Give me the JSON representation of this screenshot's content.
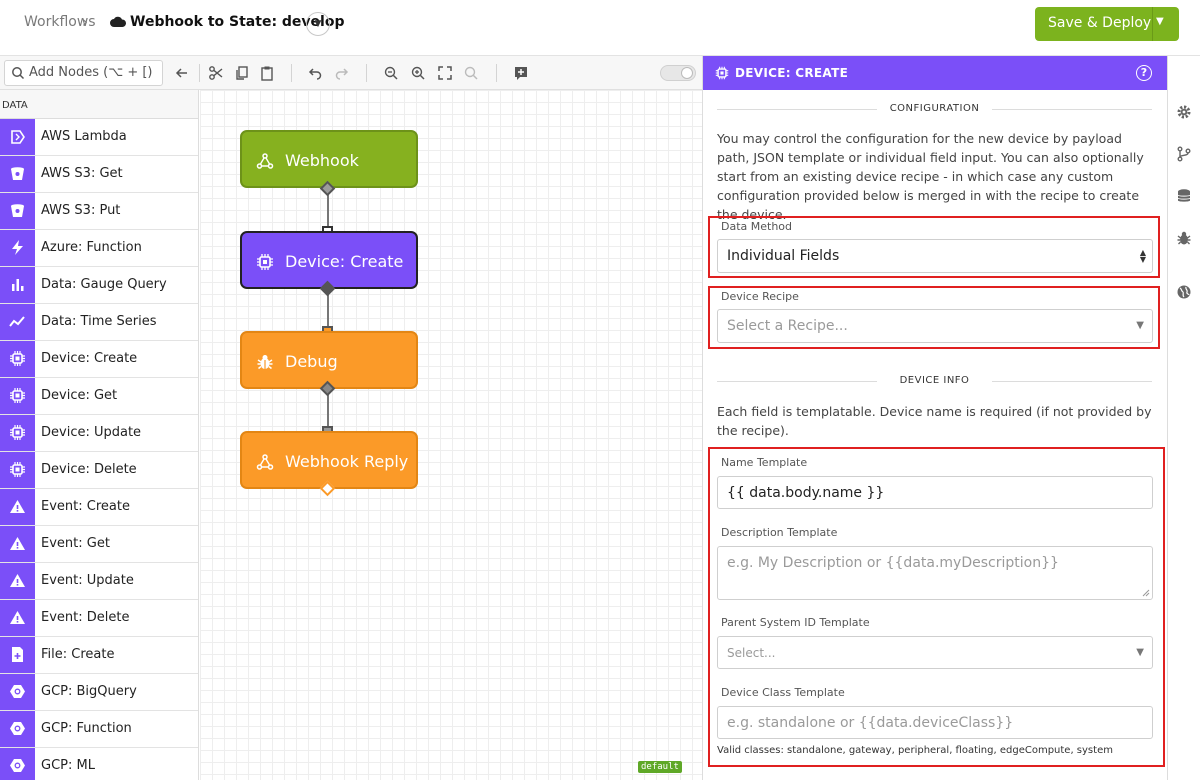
{
  "header": {
    "breadcrumb_root": "Workflows",
    "breadcrumb_sep": "›",
    "workflow_name": "Webhook to State: develop",
    "deploy_label": "Save & Deploy"
  },
  "toolbar": {
    "add_nodes_placeholder": "Add Nodes (⌥ + [)"
  },
  "sidebar": {
    "category": "DATA",
    "items": [
      {
        "label": "AWS Lambda",
        "icon": "aws-lambda-icon"
      },
      {
        "label": "AWS S3: Get",
        "icon": "bucket-icon"
      },
      {
        "label": "AWS S3: Put",
        "icon": "bucket-icon"
      },
      {
        "label": "Azure: Function",
        "icon": "lightning-icon"
      },
      {
        "label": "Data: Gauge Query",
        "icon": "bar-chart-icon"
      },
      {
        "label": "Data: Time Series",
        "icon": "line-chart-icon"
      },
      {
        "label": "Device: Create",
        "icon": "chip-icon"
      },
      {
        "label": "Device: Get",
        "icon": "chip-icon"
      },
      {
        "label": "Device: Update",
        "icon": "chip-icon"
      },
      {
        "label": "Device: Delete",
        "icon": "chip-icon"
      },
      {
        "label": "Event: Create",
        "icon": "event-icon"
      },
      {
        "label": "Event: Get",
        "icon": "event-icon"
      },
      {
        "label": "Event: Update",
        "icon": "event-icon"
      },
      {
        "label": "Event: Delete",
        "icon": "event-icon"
      },
      {
        "label": "File: Create",
        "icon": "file-icon"
      },
      {
        "label": "GCP: BigQuery",
        "icon": "gcp-icon"
      },
      {
        "label": "GCP: Function",
        "icon": "gcp-icon"
      },
      {
        "label": "GCP: ML",
        "icon": "gcp-icon"
      }
    ]
  },
  "canvas": {
    "nodes": [
      {
        "label": "Webhook",
        "color": "#86b11f"
      },
      {
        "label": "Device: Create",
        "color": "#7b4ff8"
      },
      {
        "label": "Debug",
        "color": "#fb9a28"
      },
      {
        "label": "Webhook Reply",
        "color": "#fb9a28"
      }
    ],
    "badge": "default"
  },
  "panel": {
    "title": "DEVICE: CREATE",
    "help": "?",
    "config_title": "CONFIGURATION",
    "config_text": "You may control the configuration for the new device by payload path, JSON template or individual field input. You can also optionally start from an existing device recipe - in which case any custom configuration provided below is merged in with the recipe to create the device.",
    "data_method_label": "Data Method",
    "data_method_value": "Individual Fields",
    "device_recipe_label": "Device Recipe",
    "device_recipe_placeholder": "Select a Recipe...",
    "info_title": "DEVICE INFO",
    "info_text": "Each field is templatable. Device name is required (if not provided by the recipe).",
    "name_label": "Name Template",
    "name_value": "{{ data.body.name }}",
    "desc_label": "Description Template",
    "desc_placeholder": "e.g. My Description or {{data.myDescription}}",
    "parent_label": "Parent System ID Template",
    "parent_placeholder": "Select...",
    "class_label": "Device Class Template",
    "class_placeholder": "e.g. standalone or {{data.deviceClass}}",
    "valid_classes": "Valid classes: standalone, gateway, peripheral, floating, edgeCompute, system"
  },
  "colors": {
    "accent_purple": "#7b4ff8",
    "deploy_green": "#7cb31e",
    "highlight_red": "#e02020"
  }
}
